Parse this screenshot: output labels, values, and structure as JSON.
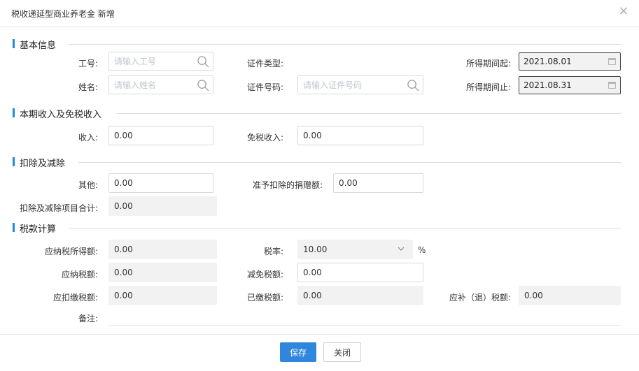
{
  "dialog": {
    "title": "税收递延型商业养老金 新增",
    "close_icon": "×"
  },
  "sections": {
    "basic": "基本信息",
    "income": "本期收入及免税收入",
    "deduct": "扣除及减除",
    "tax": "税款计算"
  },
  "basic": {
    "emp_no": {
      "label": "工号:",
      "placeholder": "请输入工号"
    },
    "name": {
      "label": "姓名:",
      "placeholder": "请输入姓名"
    },
    "id_type": {
      "label": "证件类型:",
      "value": ""
    },
    "id_no": {
      "label": "证件号码:",
      "placeholder": "请输入证件号码"
    },
    "period_start": {
      "label": "所得期间起:",
      "value": "2021.08.01"
    },
    "period_end": {
      "label": "所得期间止:",
      "value": "2021.08.31"
    }
  },
  "income": {
    "income": {
      "label": "收入:",
      "value": "0.00"
    },
    "tax_free": {
      "label": "免税收入:",
      "value": "0.00"
    }
  },
  "deduct": {
    "other": {
      "label": "其他:",
      "value": "0.00"
    },
    "donation": {
      "label": "准予扣除的捐赠额:",
      "value": "0.00"
    },
    "total": {
      "label": "扣除及减除项目合计:",
      "value": "0.00"
    }
  },
  "tax": {
    "taxable_income": {
      "label": "应纳税所得额:",
      "value": "0.00"
    },
    "rate": {
      "label": "税率:",
      "value": "10.00",
      "unit": "%"
    },
    "tax_payable": {
      "label": "应纳税额:",
      "value": "0.00"
    },
    "tax_relief": {
      "label": "减免税额:",
      "value": "0.00"
    },
    "withholding": {
      "label": "应扣缴税额:",
      "value": "0.00"
    },
    "paid": {
      "label": "已缴税额:",
      "value": "0.00"
    },
    "refund": {
      "label": "应补（退）税额:",
      "value": "0.00"
    },
    "note": {
      "label": "备注:",
      "value": ""
    }
  },
  "footer": {
    "save": "保存",
    "close": "关闭"
  },
  "colors": {
    "accent": "#2f86dd",
    "section_bar": "#1e88e5"
  }
}
